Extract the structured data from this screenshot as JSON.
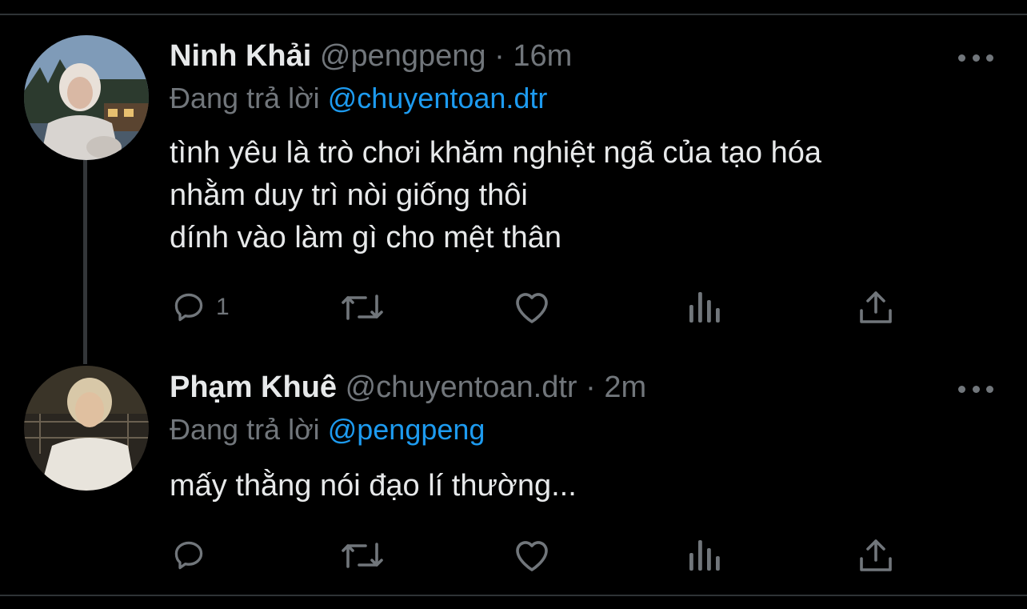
{
  "tweets": [
    {
      "name": "Ninh Khải",
      "handle": "@pengpeng",
      "separator": "·",
      "time": "16m",
      "replying_prefix": "Đang trả lời",
      "replying_to": "@chuyentoan.dtr",
      "lines": [
        "tình yêu là trò chơi khăm nghiệt ngã của tạo hóa",
        "nhằm duy trì nòi giống thôi",
        "dính vào làm gì cho mệt thân"
      ],
      "reply_count": "1",
      "icons": [
        "reply-icon",
        "retweet-icon",
        "like-icon",
        "analytics-icon",
        "share-icon",
        "more-icon"
      ]
    },
    {
      "name": "Phạm Khuê",
      "handle": "@chuyentoan.dtr",
      "separator": "·",
      "time": "2m",
      "replying_prefix": "Đang trả lời",
      "replying_to": "@pengpeng",
      "lines": [
        "mấy thằng nói đạo lí thường..."
      ],
      "reply_count": "",
      "icons": [
        "reply-icon",
        "retweet-icon",
        "like-icon",
        "analytics-icon",
        "share-icon",
        "more-icon"
      ]
    }
  ],
  "colors": {
    "background": "#000000",
    "text": "#e7e9ea",
    "muted": "#71767b",
    "accent": "#1d9bf0",
    "divider": "#2f3336"
  }
}
